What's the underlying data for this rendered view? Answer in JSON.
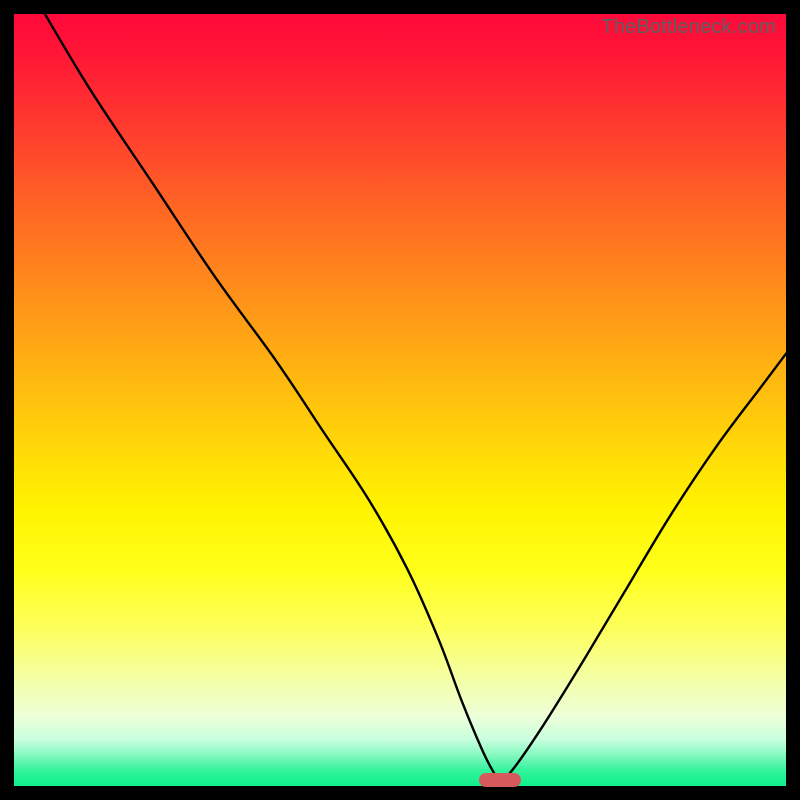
{
  "watermark": "TheBottleneck.com",
  "chart_data": {
    "type": "line",
    "title": "",
    "xlabel": "",
    "ylabel": "",
    "xlim": [
      0,
      100
    ],
    "ylim": [
      0,
      100
    ],
    "x": [
      4,
      10,
      18,
      26,
      34,
      40,
      46,
      51,
      55,
      58,
      60.5,
      62,
      63,
      64.5,
      68,
      73,
      79,
      85,
      91,
      97,
      100
    ],
    "values": [
      100,
      90,
      78,
      66,
      55,
      46,
      37,
      28,
      19,
      11,
      5,
      2,
      0.8,
      2,
      7,
      15,
      25,
      35,
      44,
      52,
      56
    ],
    "marker": {
      "x": 63,
      "y": 0.8
    },
    "gradient_stops": [
      {
        "pos": 0,
        "color": "#ff083a"
      },
      {
        "pos": 50,
        "color": "#ffca0b"
      },
      {
        "pos": 75,
        "color": "#fdff2a"
      },
      {
        "pos": 100,
        "color": "#0ef089"
      }
    ]
  }
}
